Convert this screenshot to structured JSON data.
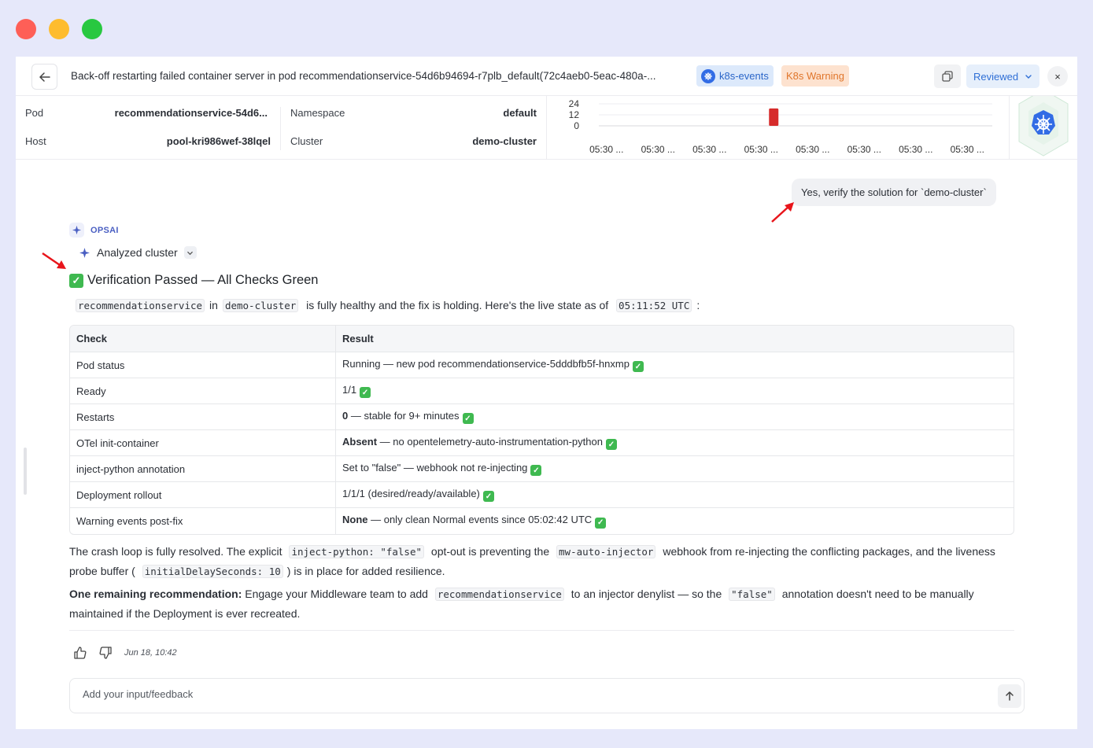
{
  "window_controls": [
    "close",
    "minimize",
    "maximize"
  ],
  "header": {
    "title": "Back-off restarting failed container server in pod recommendationservice-54d6b94694-r7plb_default(72c4aeb0-5eac-480a-...",
    "badges": [
      {
        "label": "k8s-events",
        "icon": "kubernetes-icon",
        "color": "#2b66c8"
      },
      {
        "label": "K8s Warning",
        "color": "#e0762c"
      }
    ],
    "status": "Reviewed",
    "close_label": "×"
  },
  "meta": {
    "pod_label": "Pod",
    "pod_value": "recommendationservice-54d6...",
    "namespace_label": "Namespace",
    "namespace_value": "default",
    "host_label": "Host",
    "host_value": "pool-kri986wef-38lqel",
    "cluster_label": "Cluster",
    "cluster_value": "demo-cluster"
  },
  "chart_data": {
    "type": "bar",
    "title": "",
    "yticks": [
      "24",
      "12",
      "0"
    ],
    "ylim": [
      0,
      24
    ],
    "categories": [
      "05:30 ...",
      "05:30 ...",
      "05:30 ...",
      "05:30 ...",
      "05:30 ...",
      "05:30 ...",
      "05:30 ...",
      "05:30 ..."
    ],
    "series": [
      {
        "values": [
          0,
          0,
          0,
          19,
          0,
          0,
          0,
          0
        ],
        "color": "#d62b2b"
      }
    ],
    "grid": true
  },
  "conversation": {
    "user_message": "Yes, verify the solution for `demo-cluster`",
    "assistant_name": "OPSAI",
    "analyzed_label": "Analyzed cluster",
    "heading": "Verification Passed — All Checks Green",
    "intro": {
      "service": "recommendationservice",
      "in": "in",
      "cluster": "demo-cluster",
      "text": "is fully healthy and the fix is holding. Here's the live state as of",
      "time": "05:11:52 UTC",
      "end": ":"
    },
    "table": {
      "headers": [
        "Check",
        "Result"
      ],
      "rows": [
        {
          "check": "Pod status",
          "bold": "",
          "result": "Running — new pod recommendationservice-5dddbfb5f-hnxmp"
        },
        {
          "check": "Ready",
          "bold": "",
          "result": "1/1"
        },
        {
          "check": "Restarts",
          "bold": "0",
          "result": " — stable for 9+ minutes"
        },
        {
          "check": "OTel init-container",
          "bold": "Absent",
          "result": " — no opentelemetry-auto-instrumentation-python"
        },
        {
          "check": "inject-python annotation",
          "bold": "",
          "result": "Set to \"false\" — webhook not re-injecting"
        },
        {
          "check": "Deployment rollout",
          "bold": "",
          "result": "1/1/1 (desired/ready/available)"
        },
        {
          "check": "Warning events post-fix",
          "bold": "None",
          "result": " — only clean Normal events since 05:02:42 UTC"
        }
      ]
    },
    "summary": {
      "p1_a": "The crash loop is fully resolved. The explicit",
      "p1_code1": "inject-python: \"false\"",
      "p1_b": "opt-out is preventing the",
      "p1_code2": "mw-auto-injector",
      "p1_c": "webhook from re-injecting the conflicting packages, and the liveness probe buffer (",
      "p1_code3": "initialDelaySeconds: 10",
      "p1_d": ") is in place for added resilience.",
      "p2_bold": "One remaining recommendation:",
      "p2_a": "Engage your Middleware team to add",
      "p2_code1": "recommendationservice",
      "p2_b": "to an injector denylist — so the",
      "p2_code2": "\"false\"",
      "p2_c": "annotation doesn't need to be manually maintained if the Deployment is ever recreated."
    },
    "timestamp": "Jun 18, 10:42"
  },
  "input": {
    "placeholder": "Add your input/feedback",
    "value": ""
  },
  "colors": {
    "accent": "#2f6fd6",
    "warning": "#e0762c",
    "success": "#3fb950",
    "error_bar": "#d62b2b",
    "annotation_arrow": "#e8151b"
  }
}
